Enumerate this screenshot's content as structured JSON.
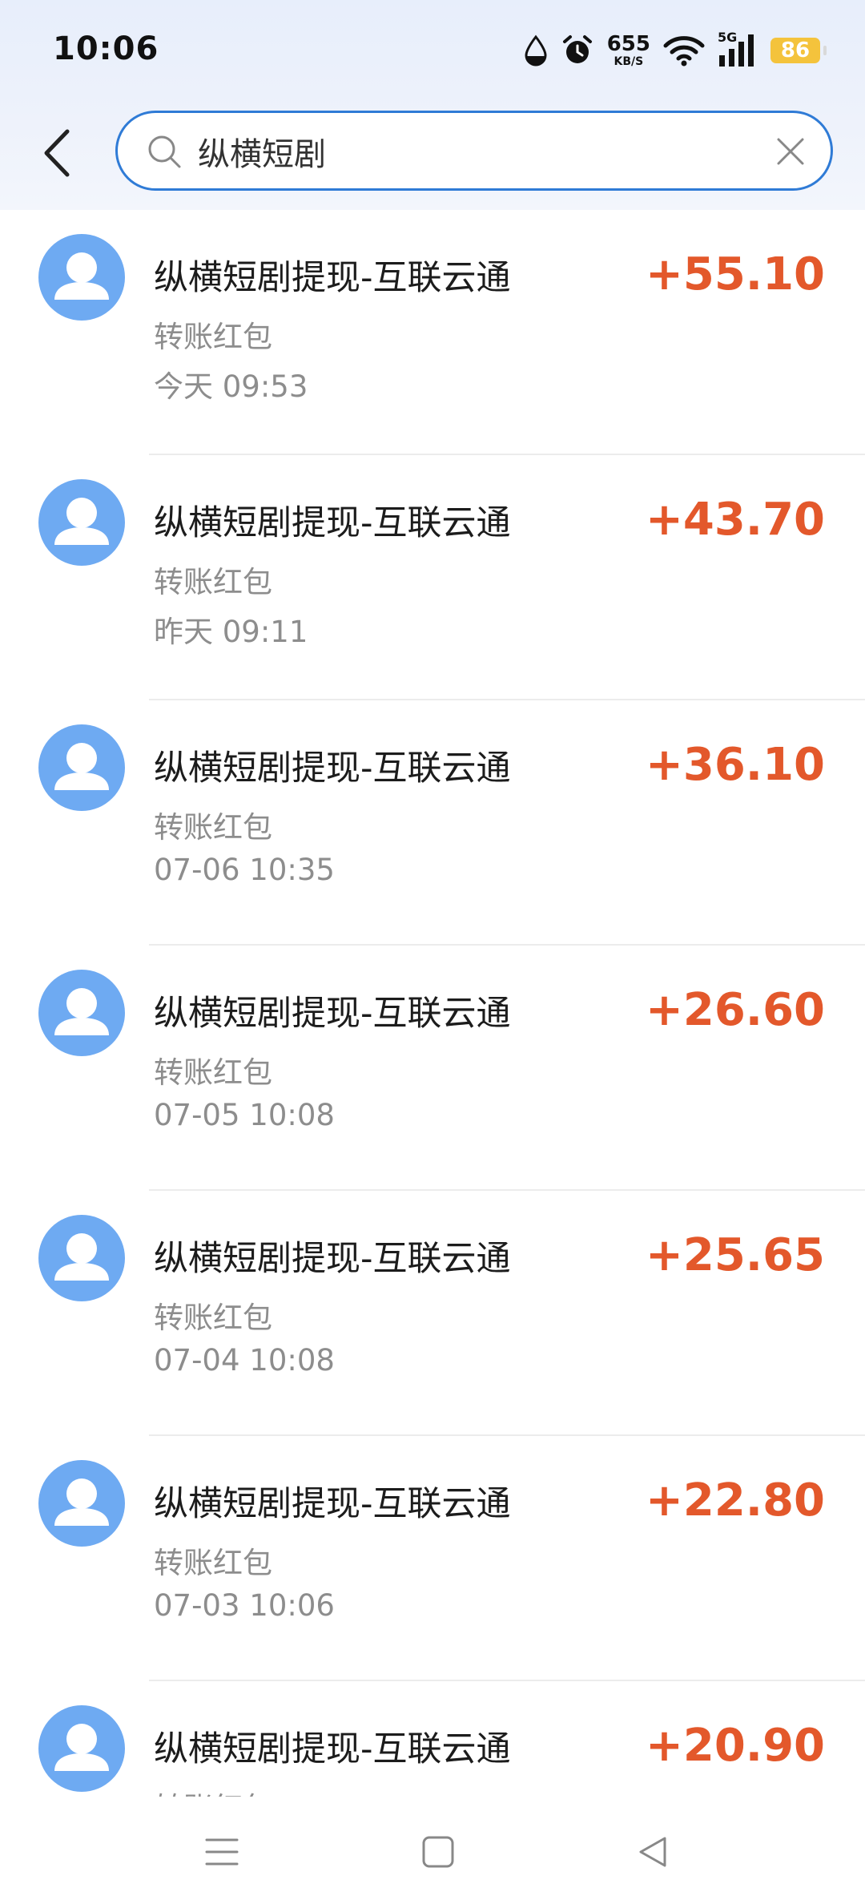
{
  "status_bar": {
    "time": "10:06",
    "net_speed_value": "655",
    "net_speed_unit": "KB/S",
    "network": "5G",
    "battery": "86",
    "icons": [
      "water-drop-icon",
      "alarm-icon",
      "wifi-icon",
      "signal-icon",
      "battery-icon"
    ]
  },
  "search": {
    "value": "纵横短剧",
    "icons": [
      "back-arrow-icon",
      "search-icon",
      "clear-icon"
    ]
  },
  "colors": {
    "accent_blue": "#2f7bd6",
    "avatar_blue": "#6eaaf2",
    "amount_orange": "#e3582b",
    "battery_yellow": "#f4c33c"
  },
  "transactions": [
    {
      "title": "纵横短剧提现-互联云通",
      "type": "转账红包",
      "time": "今天 09:53",
      "amount": "+55.10"
    },
    {
      "title": "纵横短剧提现-互联云通",
      "type": "转账红包",
      "time": "昨天 09:11",
      "amount": "+43.70"
    },
    {
      "title": "纵横短剧提现-互联云通",
      "type": "转账红包",
      "time": "07-06 10:35",
      "amount": "+36.10"
    },
    {
      "title": "纵横短剧提现-互联云通",
      "type": "转账红包",
      "time": "07-05 10:08",
      "amount": "+26.60"
    },
    {
      "title": "纵横短剧提现-互联云通",
      "type": "转账红包",
      "time": "07-04 10:08",
      "amount": "+25.65"
    },
    {
      "title": "纵横短剧提现-互联云通",
      "type": "转账红包",
      "time": "07-03 10:06",
      "amount": "+22.80"
    },
    {
      "title": "纵横短剧提现-互联云通",
      "type": "转账红包",
      "time": "",
      "amount": "+20.90"
    }
  ],
  "nav_bar": {
    "icons": [
      "menu-icon",
      "home-icon",
      "back-icon"
    ]
  }
}
